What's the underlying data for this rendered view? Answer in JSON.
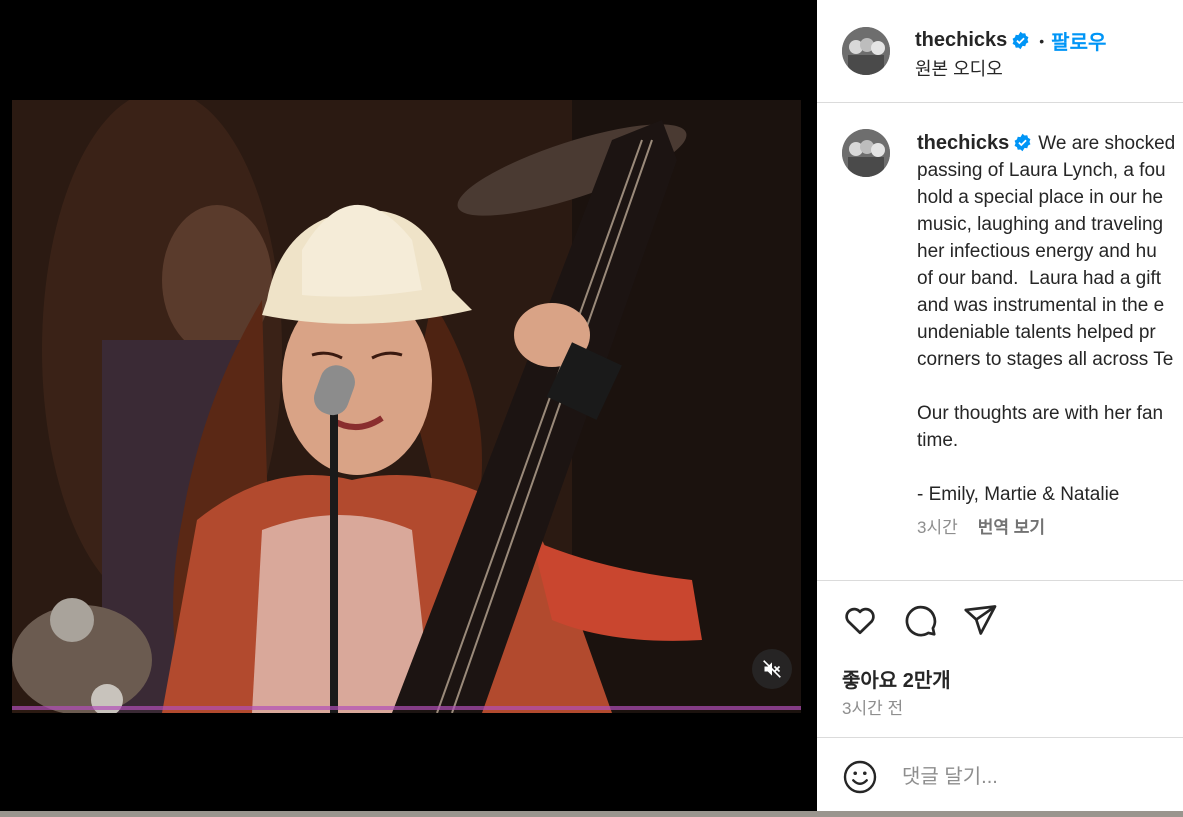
{
  "post": {
    "username": "thechicks",
    "separator": "•",
    "follow_label": "팔로우",
    "audio_label": "원본 오디오",
    "caption_lines": [
      "We are shocked",
      "passing of Laura Lynch, a fou",
      "hold a special place in our he",
      "music, laughing and traveling",
      "her infectious energy and hu",
      "of our band.  Laura had a gift",
      "and was instrumental in the e",
      "undeniable talents helped pr",
      "corners to stages all across Te",
      "",
      "Our thoughts are with her fan",
      "time.",
      "",
      "- Emily, Martie & Natalie"
    ],
    "caption_time": "3시간",
    "translate_label": "번역 보기",
    "likes_label": "좋아요 2만개",
    "posted_label": "3시간 전",
    "comment_placeholder": "댓글 달기..."
  },
  "icons": {
    "verified": "verified-badge-icon",
    "like": "heart-icon",
    "comment": "speech-bubble-icon",
    "share": "paper-plane-icon",
    "emoji": "smiley-icon",
    "mute": "speaker-muted-icon"
  },
  "colors": {
    "accent": "#0095f6",
    "text": "#262626",
    "secondary": "#8e8e8e",
    "divider": "#dbdbdb"
  }
}
